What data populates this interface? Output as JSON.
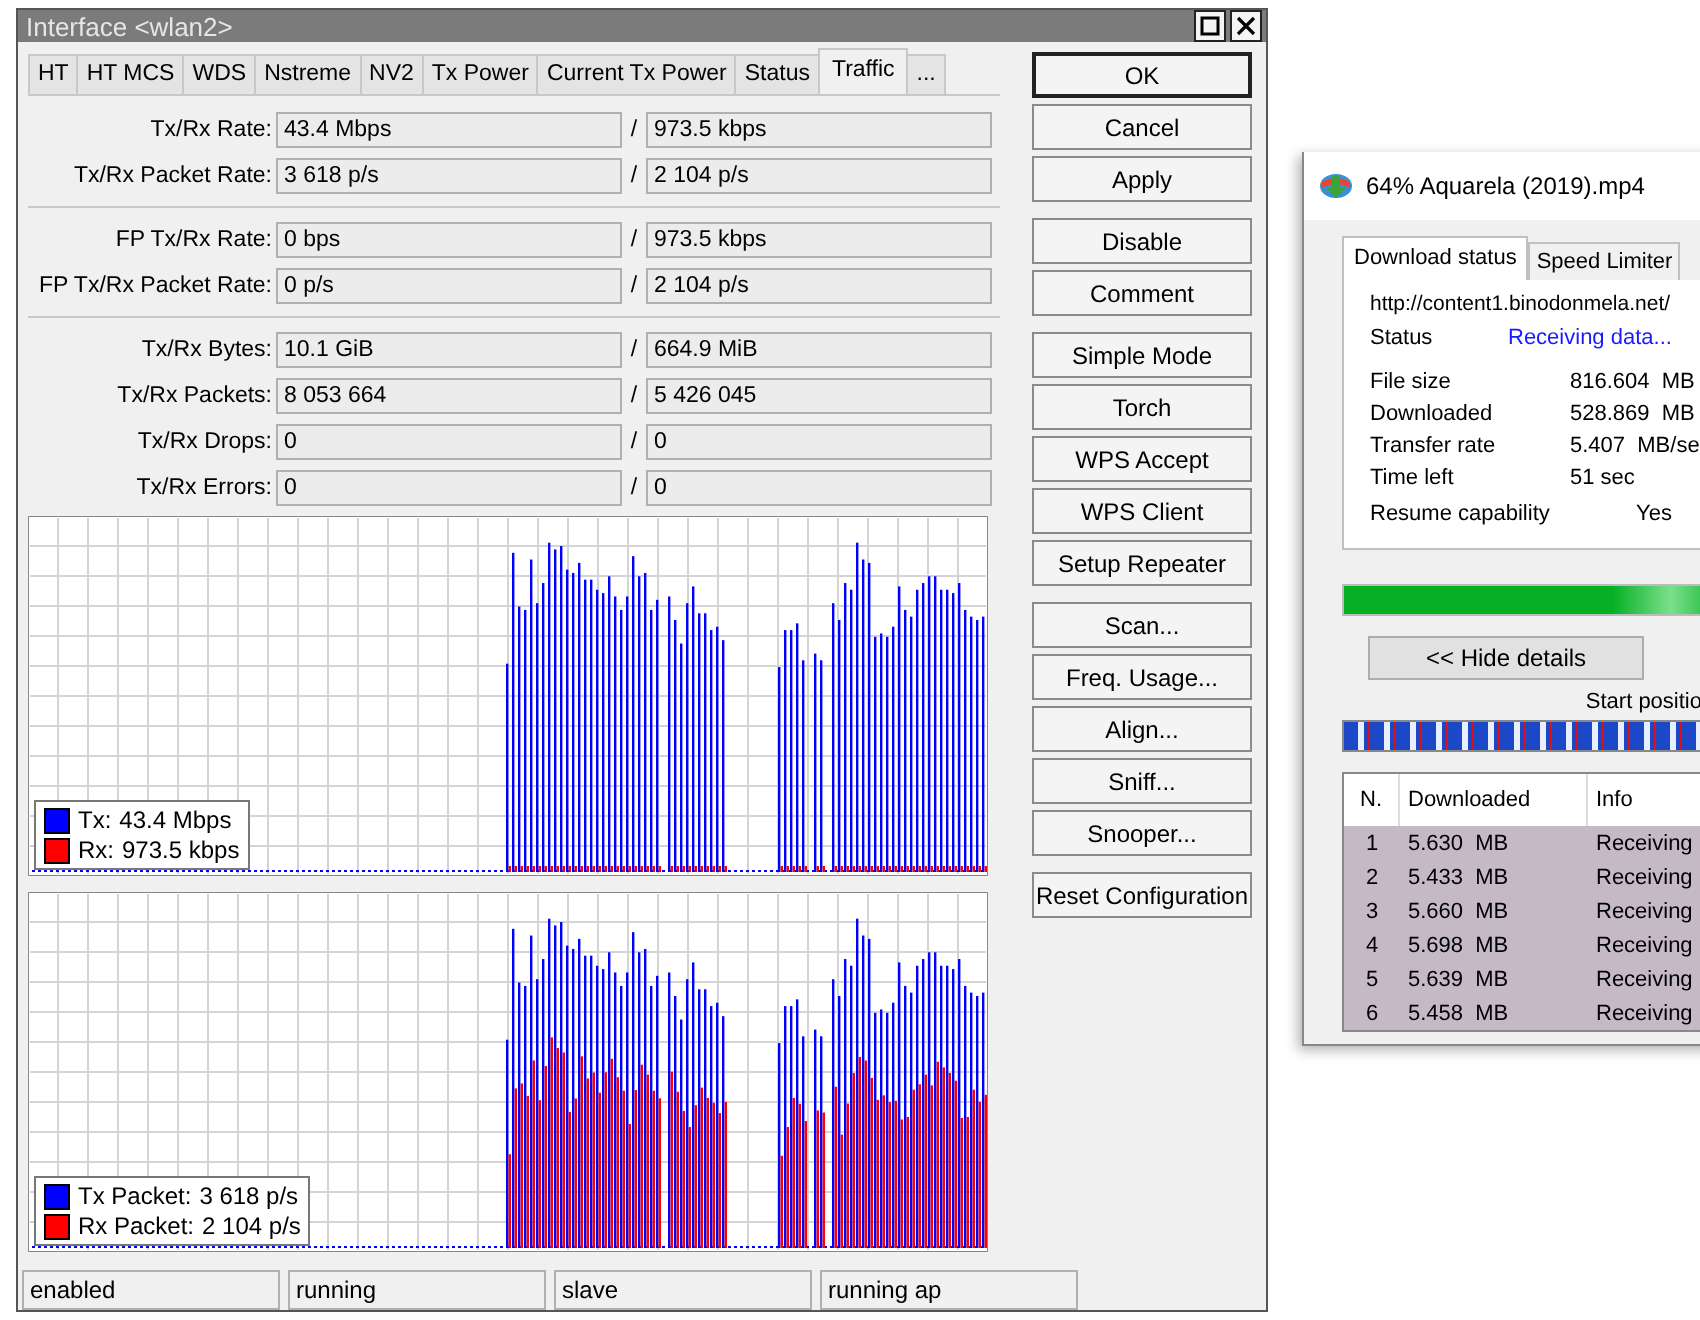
{
  "window": {
    "title": "Interface <wlan2>"
  },
  "tabs": [
    {
      "label": "HT",
      "selected": false
    },
    {
      "label": "HT MCS",
      "selected": false
    },
    {
      "label": "WDS",
      "selected": false
    },
    {
      "label": "Nstreme",
      "selected": false
    },
    {
      "label": "NV2",
      "selected": false
    },
    {
      "label": "Tx Power",
      "selected": false
    },
    {
      "label": "Current Tx Power",
      "selected": false
    },
    {
      "label": "Status",
      "selected": false
    },
    {
      "label": "Traffic",
      "selected": true
    },
    {
      "label": "...",
      "selected": false
    }
  ],
  "stat_groups": [
    {
      "rows": [
        {
          "label": "Tx/Rx Rate:",
          "tx": "43.4 Mbps",
          "divider": "/",
          "rx": "973.5 kbps"
        },
        {
          "label": "Tx/Rx Packet Rate:",
          "tx": "3 618 p/s",
          "divider": "/",
          "rx": "2 104 p/s"
        }
      ]
    },
    {
      "rows": [
        {
          "label": "FP Tx/Rx Rate:",
          "tx": "0 bps",
          "divider": "/",
          "rx": "973.5 kbps"
        },
        {
          "label": "FP Tx/Rx Packet Rate:",
          "tx": "0 p/s",
          "divider": "/",
          "rx": "2 104 p/s"
        }
      ]
    },
    {
      "rows": [
        {
          "label": "Tx/Rx Bytes:",
          "tx": "10.1 GiB",
          "divider": "/",
          "rx": "664.9 MiB"
        },
        {
          "label": "Tx/Rx Packets:",
          "tx": "8 053 664",
          "divider": "/",
          "rx": "5 426 045"
        },
        {
          "label": "Tx/Rx Drops:",
          "tx": "0",
          "divider": "/",
          "rx": "0"
        },
        {
          "label": "Tx/Rx Errors:",
          "tx": "0",
          "divider": "/",
          "rx": "0"
        }
      ]
    }
  ],
  "graphs": [
    {
      "kind": "rate",
      "legend": [
        {
          "label": "Tx:",
          "value": "43.4 Mbps",
          "color": "#0000ff"
        },
        {
          "label": "Rx:",
          "value": "973.5 kbps",
          "color": "#ff0000"
        }
      ]
    },
    {
      "kind": "packets",
      "legend": [
        {
          "label": "Tx Packet:",
          "value": "3 618 p/s",
          "color": "#0000ff"
        },
        {
          "label": "Rx Packet:",
          "value": "2 104 p/s",
          "color": "#ff0000"
        }
      ]
    }
  ],
  "button_groups": [
    [
      {
        "label": "OK",
        "default": true
      },
      {
        "label": "Cancel",
        "default": false
      },
      {
        "label": "Apply",
        "default": false
      }
    ],
    [
      {
        "label": "Disable",
        "default": false
      },
      {
        "label": "Comment",
        "default": false
      }
    ],
    [
      {
        "label": "Simple Mode",
        "default": false
      },
      {
        "label": "Torch",
        "default": false
      },
      {
        "label": "WPS Accept",
        "default": false
      },
      {
        "label": "WPS Client",
        "default": false
      },
      {
        "label": "Setup Repeater",
        "default": false
      }
    ],
    [
      {
        "label": "Scan...",
        "default": false
      },
      {
        "label": "Freq. Usage...",
        "default": false
      },
      {
        "label": "Align...",
        "default": false
      },
      {
        "label": "Sniff...",
        "default": false
      },
      {
        "label": "Snooper...",
        "default": false
      }
    ],
    [
      {
        "label": "Reset Configuration",
        "default": false
      }
    ]
  ],
  "status_bar": [
    "enabled",
    "running",
    "slave",
    "running ap"
  ],
  "download_window": {
    "title": "64% Aquarela (2019).mp4",
    "tabs": [
      {
        "label": "Download status",
        "selected": true
      },
      {
        "label": "Speed Limiter",
        "selected": false
      }
    ],
    "url": "http://content1.binodonmela.net/",
    "details": [
      {
        "kind": "status",
        "label": "Status",
        "value": "Receiving data..."
      },
      {
        "kind": "value",
        "label": "File size",
        "value": "816.604  MB"
      },
      {
        "kind": "value",
        "label": "Downloaded",
        "value": "528.869  MB"
      },
      {
        "kind": "value",
        "label": "Transfer rate",
        "value": "5.407  MB/se"
      },
      {
        "kind": "value",
        "label": "Time left",
        "value": "51 sec"
      },
      {
        "kind": "flag",
        "label": "Resume capability",
        "value": "Yes"
      }
    ],
    "progress": {
      "level": 0.64
    },
    "hide_details_button": "<< Hide details",
    "start_position_label": "Start positio",
    "connections": {
      "columns": [
        "N.",
        "Downloaded",
        "Info"
      ],
      "rows": [
        [
          "1",
          "5.630  MB",
          "Receiving"
        ],
        [
          "2",
          "5.433  MB",
          "Receiving"
        ],
        [
          "3",
          "5.660  MB",
          "Receiving"
        ],
        [
          "4",
          "5.698  MB",
          "Receiving"
        ],
        [
          "5",
          "5.639  MB",
          "Receiving"
        ],
        [
          "6",
          "5.458  MB",
          "Receiving"
        ]
      ]
    }
  }
}
